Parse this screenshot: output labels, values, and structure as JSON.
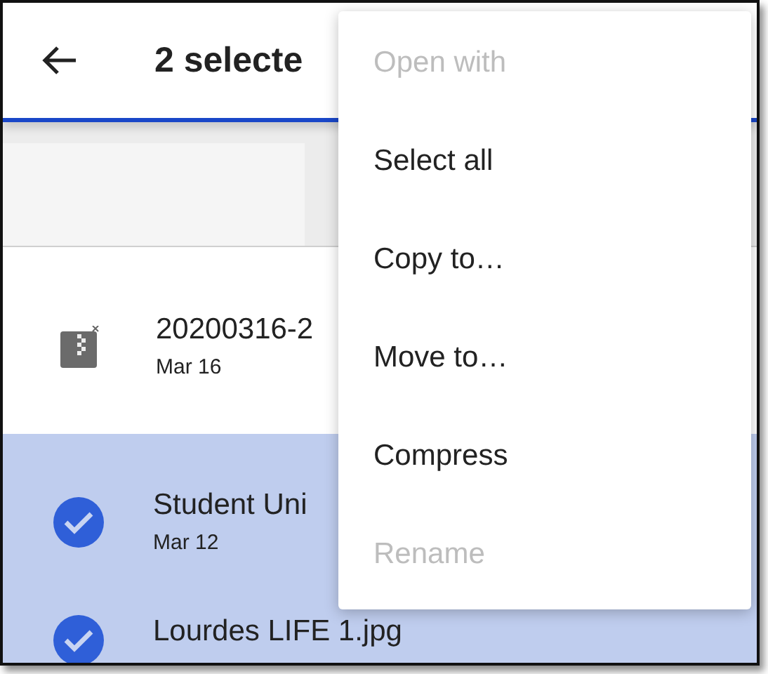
{
  "app_bar": {
    "title": "2 selecte"
  },
  "files": [
    {
      "name": "20200316-2",
      "date": "Mar 16",
      "selected": false
    },
    {
      "name": "Student Uni",
      "date": "Mar 12",
      "selected": true
    },
    {
      "name": "Lourdes LIFE 1.jpg",
      "selected": true
    }
  ],
  "menu": [
    {
      "label": "Open with",
      "disabled": true
    },
    {
      "label": "Select all",
      "disabled": false
    },
    {
      "label": "Copy to…",
      "disabled": false
    },
    {
      "label": "Move to…",
      "disabled": false
    },
    {
      "label": "Compress",
      "disabled": false
    },
    {
      "label": "Rename",
      "disabled": true
    }
  ]
}
